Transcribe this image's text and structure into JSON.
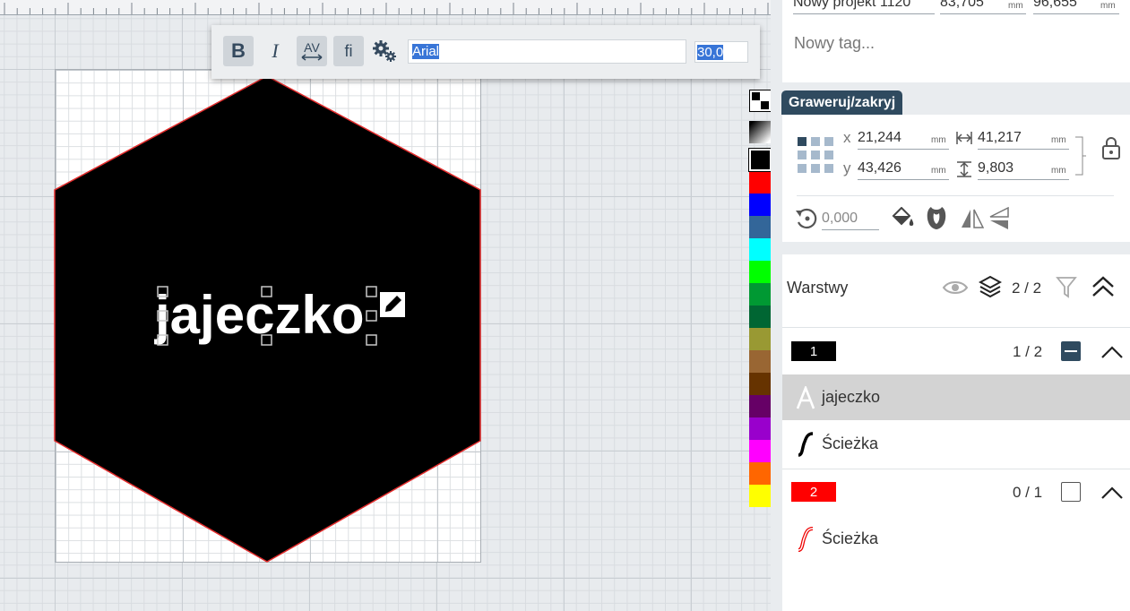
{
  "toolbar": {
    "bold_label": "B",
    "italic_label": "I",
    "kerning_label": "AV",
    "ligature_label": "fi",
    "font_value": "Arial",
    "size_value": "30,0"
  },
  "canvas": {
    "text_object": "jajeczko"
  },
  "palette": {
    "colors": [
      "#ff0000",
      "#0000ff",
      "#336699",
      "#00ffff",
      "#00ff00",
      "#009933",
      "#006633",
      "#999933",
      "#996633",
      "#663300",
      "#660066",
      "#9900cc",
      "#ff00ff",
      "#ff6600",
      "#ffff00"
    ]
  },
  "project": {
    "name": "Nowy projekt 1120",
    "width": "83,705",
    "height": "96,655",
    "unit": "mm",
    "tag_placeholder": "Nowy tag..."
  },
  "operation": {
    "mode_label": "Graweruj/zakryj"
  },
  "transform": {
    "x_label": "x",
    "y_label": "y",
    "x": "21,244",
    "y": "43,426",
    "w": "41,217",
    "h": "9,803",
    "unit": "mm",
    "rotation": "0,000"
  },
  "layers": {
    "title": "Warstwy",
    "count": "2 / 2",
    "groups": [
      {
        "number": "1",
        "color": "#000000",
        "count": "1 / 2",
        "items": [
          "jajeczko",
          "Ścieżka"
        ]
      },
      {
        "number": "2",
        "color": "#ff0000",
        "count": "0 / 1",
        "items": [
          "Ścieżka"
        ]
      }
    ]
  }
}
